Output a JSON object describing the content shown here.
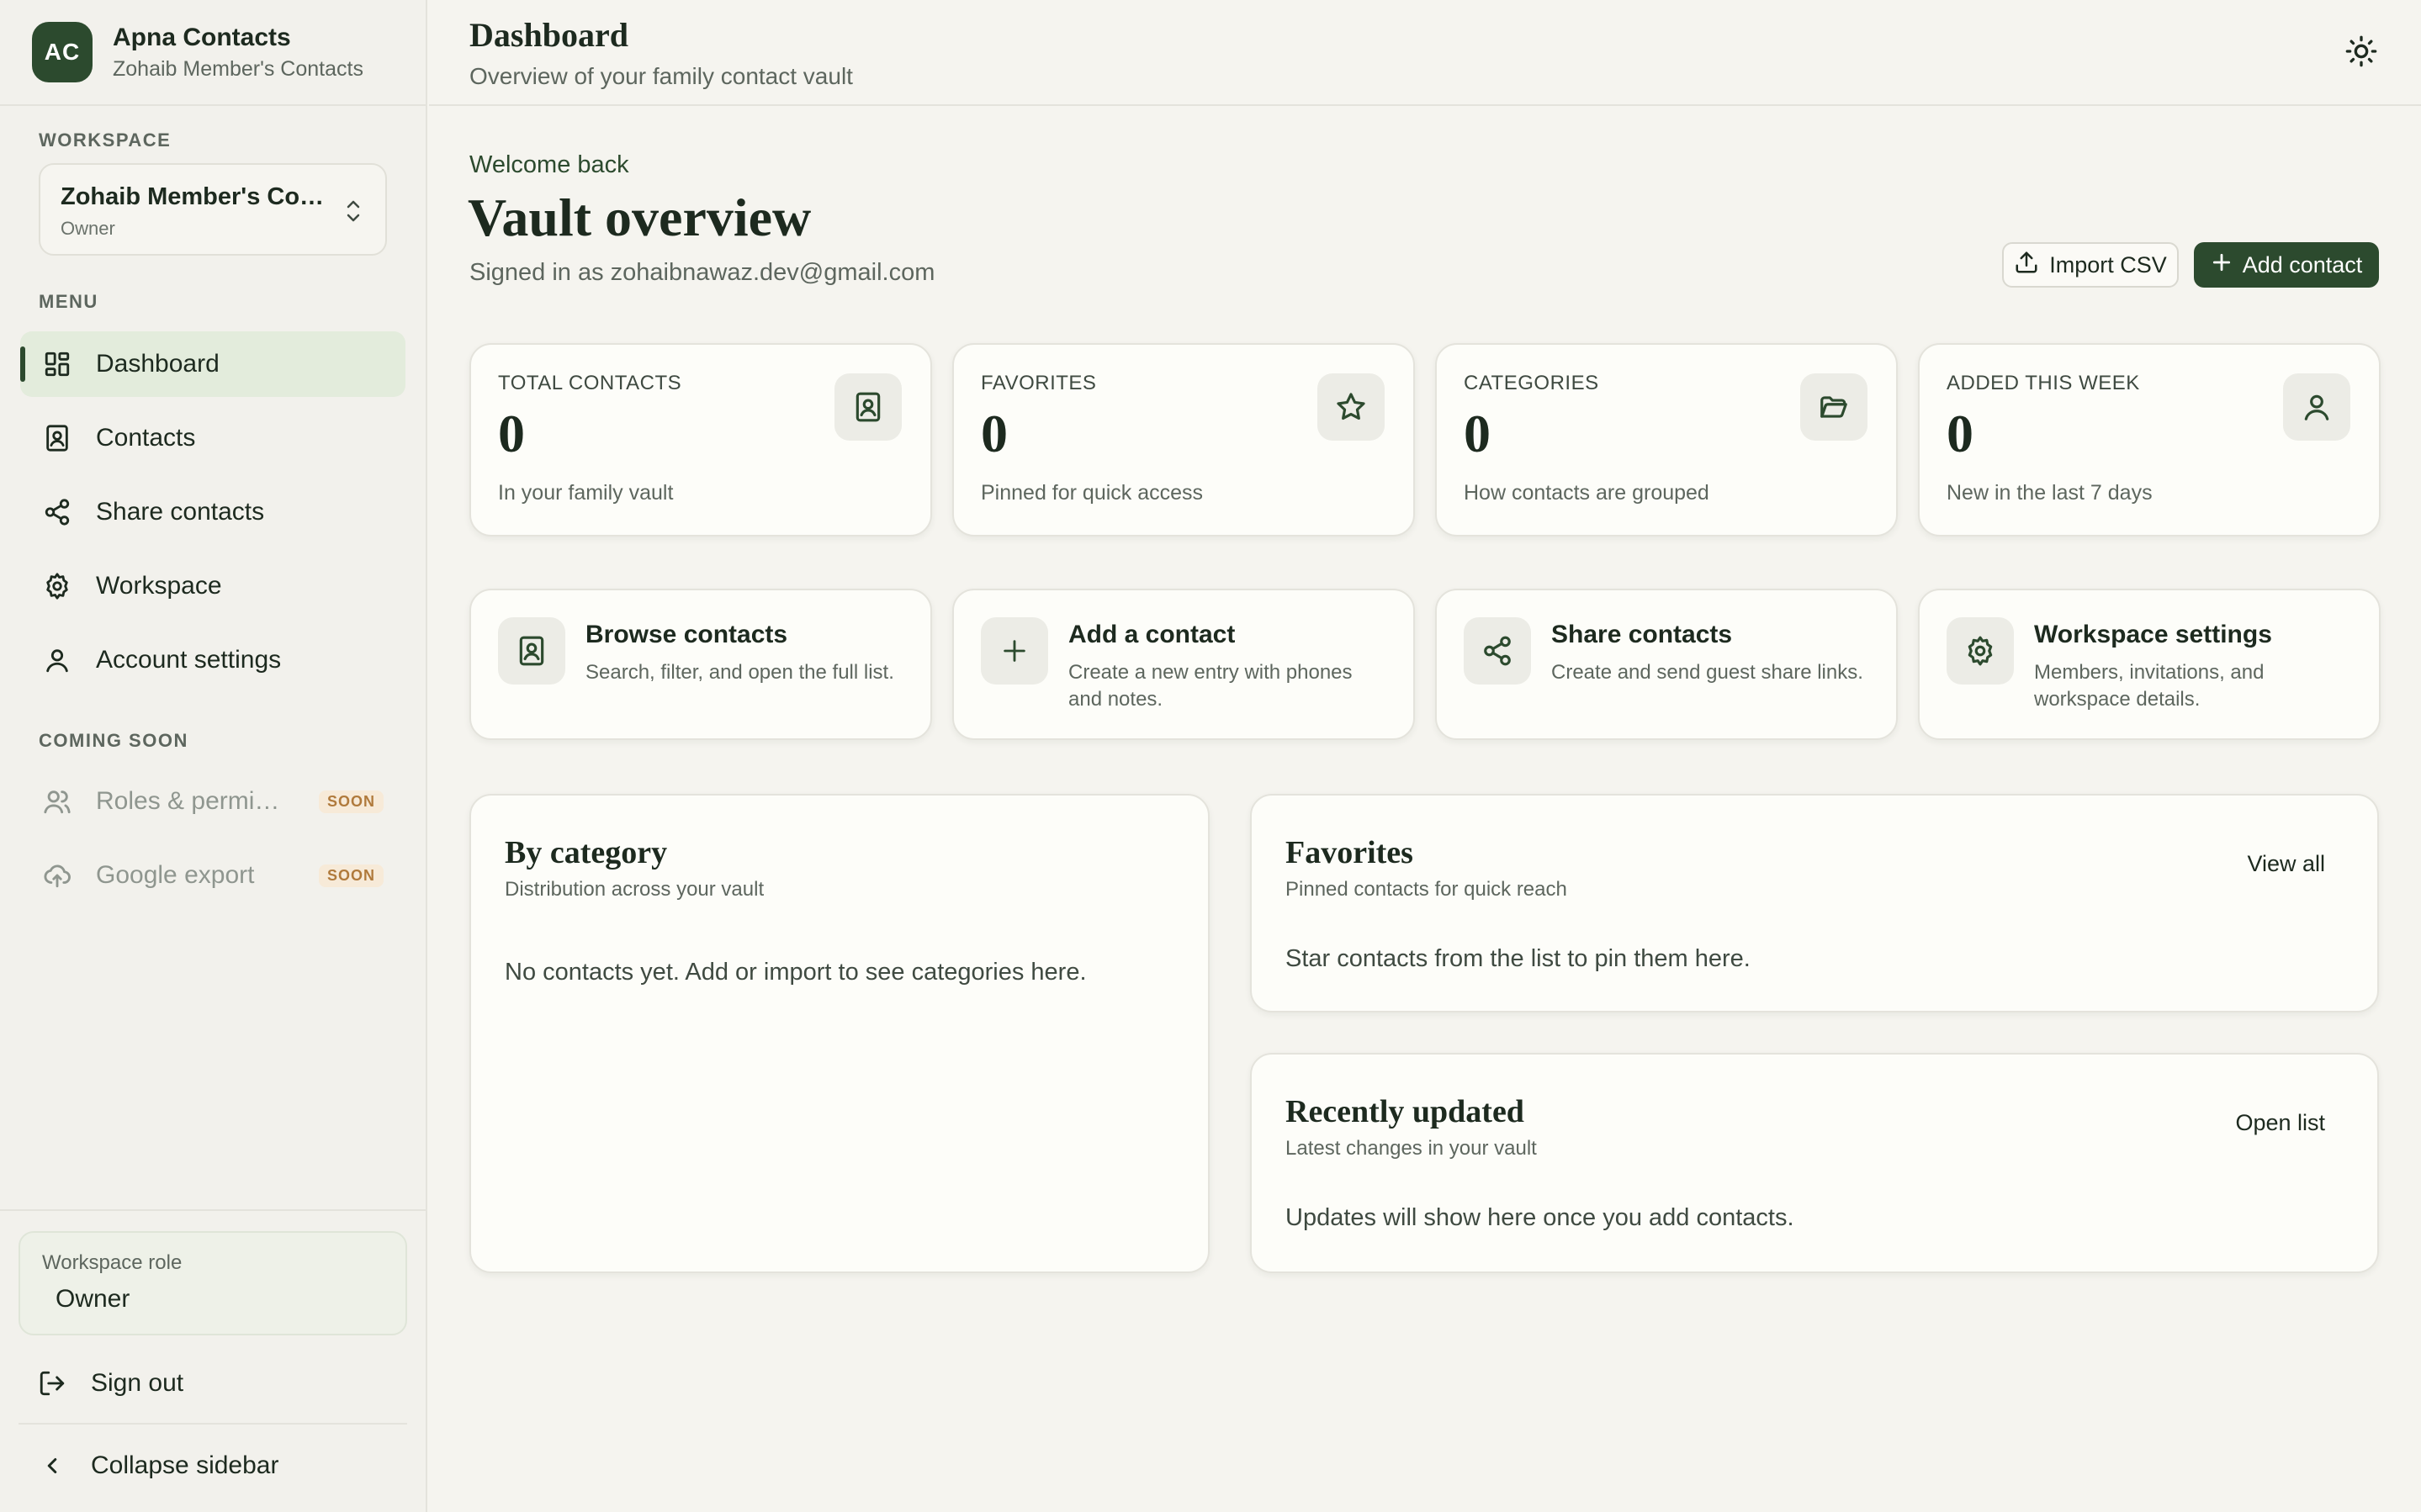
{
  "app": {
    "avatar_initials": "AC",
    "name": "Apna Contacts",
    "subtitle": "Zohaib Member's Contacts"
  },
  "workspace": {
    "section_label": "WORKSPACE",
    "selected_name": "Zohaib Member's Contacts",
    "selected_role": "Owner"
  },
  "menu": {
    "section_label": "MENU",
    "items": [
      {
        "label": "Dashboard",
        "icon": "dashboard-icon",
        "active": true
      },
      {
        "label": "Contacts",
        "icon": "contact-book-icon"
      },
      {
        "label": "Share contacts",
        "icon": "share-icon"
      },
      {
        "label": "Workspace",
        "icon": "gear-icon"
      },
      {
        "label": "Account settings",
        "icon": "user-icon"
      }
    ]
  },
  "coming_soon": {
    "section_label": "COMING SOON",
    "items": [
      {
        "label": "Roles & permissions",
        "badge": "SOON",
        "icon": "users-icon"
      },
      {
        "label": "Google export",
        "badge": "SOON",
        "icon": "cloud-upload-icon"
      }
    ]
  },
  "sidebar_footer": {
    "role_label": "Workspace role",
    "role_value": "Owner",
    "sign_out": "Sign out",
    "collapse": "Collapse sidebar"
  },
  "header": {
    "title": "Dashboard",
    "subtitle": "Overview of your family contact vault"
  },
  "hero": {
    "welcome": "Welcome back",
    "title": "Vault overview",
    "signed_in": "Signed in as zohaibnawaz.dev@gmail.com",
    "import_label": "Import CSV",
    "add_label": "Add contact"
  },
  "stats": [
    {
      "label": "TOTAL CONTACTS",
      "value": "0",
      "note": "In your family vault",
      "icon": "contact-book-icon"
    },
    {
      "label": "FAVORITES",
      "value": "0",
      "note": "Pinned for quick access",
      "icon": "star-icon"
    },
    {
      "label": "CATEGORIES",
      "value": "0",
      "note": "How contacts are grouped",
      "icon": "folder-icon"
    },
    {
      "label": "ADDED THIS WEEK",
      "value": "0",
      "note": "New in the last 7 days",
      "icon": "user-icon"
    }
  ],
  "actions": [
    {
      "title": "Browse contacts",
      "desc": "Search, filter, and open the full list.",
      "icon": "contact-book-icon"
    },
    {
      "title": "Add a contact",
      "desc": "Create a new entry with phones and notes.",
      "icon": "plus-icon"
    },
    {
      "title": "Share contacts",
      "desc": "Create and send guest share links.",
      "icon": "share-icon"
    },
    {
      "title": "Workspace settings",
      "desc": "Members, invitations, and workspace details.",
      "icon": "gear-icon"
    }
  ],
  "by_category": {
    "title": "By category",
    "subtitle": "Distribution across your vault",
    "empty": "No contacts yet. Add or import to see categories here."
  },
  "favorites": {
    "title": "Favorites",
    "subtitle": "Pinned contacts for quick reach",
    "link": "View all",
    "empty": "Star contacts from the list to pin them here."
  },
  "recent": {
    "title": "Recently updated",
    "subtitle": "Latest changes in your vault",
    "link": "Open list",
    "empty": "Updates will show here once you add contacts."
  },
  "colors": {
    "accent": "#2c4a2e",
    "background": "#f5f4ef",
    "card": "#fdfdf9",
    "active_nav": "#e3ecdc",
    "soon_badge": "#b07a3c"
  }
}
